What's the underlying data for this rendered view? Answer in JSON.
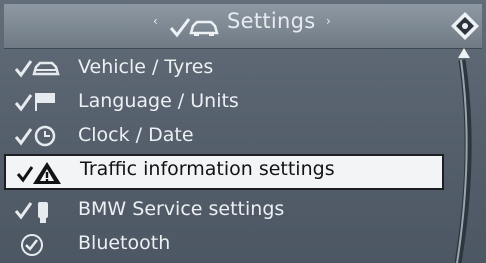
{
  "header": {
    "title": "Settings",
    "left_arrow": "‹",
    "right_arrow": "›"
  },
  "menu": {
    "items": [
      {
        "label": "Vehicle / Tyres",
        "icon": "car-check-icon"
      },
      {
        "label": "Language / Units",
        "icon": "flag-check-icon"
      },
      {
        "label": "Clock / Date",
        "icon": "clock-check-icon"
      },
      {
        "label": "Traffic information settings",
        "icon": "warning-triangle-icon",
        "selected": true
      },
      {
        "label": "BMW Service settings",
        "icon": "service-check-icon"
      },
      {
        "label": "Bluetooth",
        "icon": "bluetooth-check-icon"
      }
    ]
  },
  "colors": {
    "background": "#56616d",
    "header": "#7d8893",
    "text": "#edf0f3",
    "selected_bg": "#f3f4f5",
    "selected_text": "#111417"
  }
}
